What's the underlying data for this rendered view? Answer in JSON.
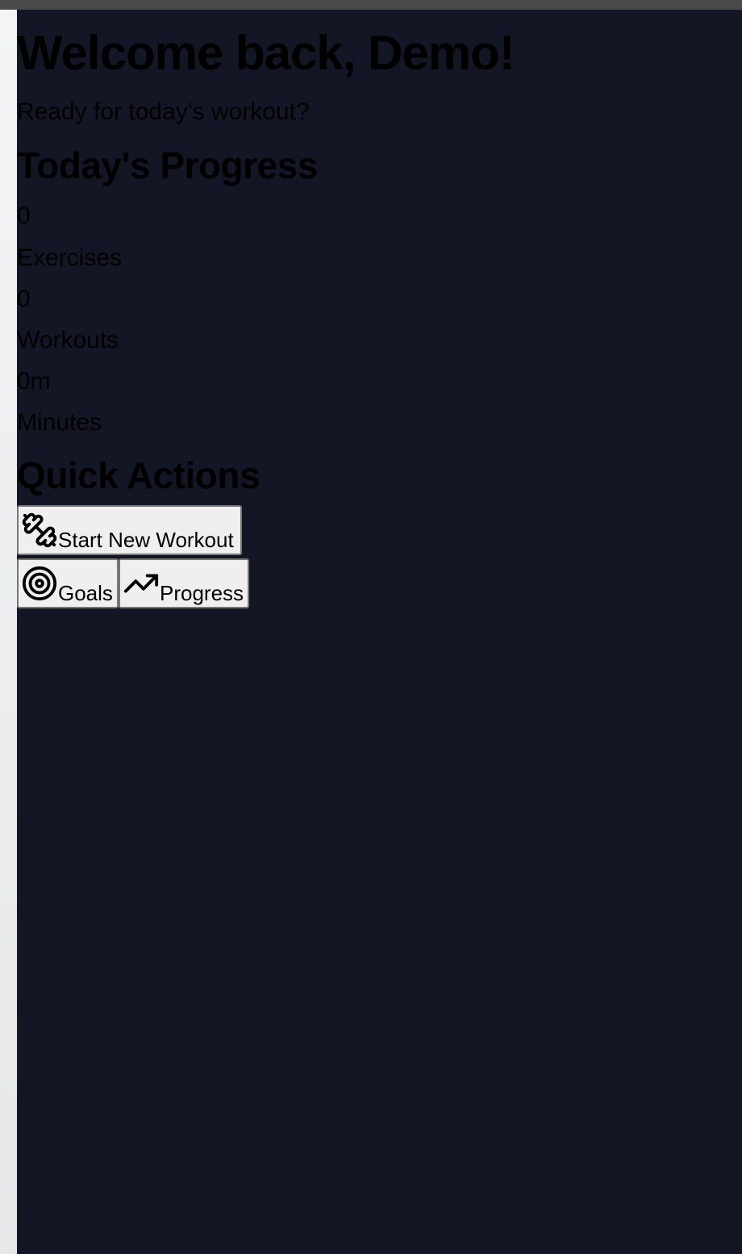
{
  "header": {
    "title": "Welcome back, Demo!",
    "subtitle": "Ready for today's workout?"
  },
  "progress": {
    "heading": "Today's Progress",
    "stats": [
      {
        "value": "0",
        "label": "Exercises"
      },
      {
        "value": "0",
        "label": "Workouts"
      },
      {
        "value": "0m",
        "label": "Minutes"
      }
    ]
  },
  "quick_actions": {
    "heading": "Quick Actions",
    "buttons": [
      {
        "label": "Start New Workout",
        "icon": "dumbbell-icon"
      },
      {
        "label": "Goals",
        "icon": "target-icon"
      },
      {
        "label": "Progress",
        "icon": "trending-up-icon"
      }
    ]
  },
  "colors": {
    "background": "#131725",
    "button_bg": "#efefef",
    "text": "#000000"
  }
}
